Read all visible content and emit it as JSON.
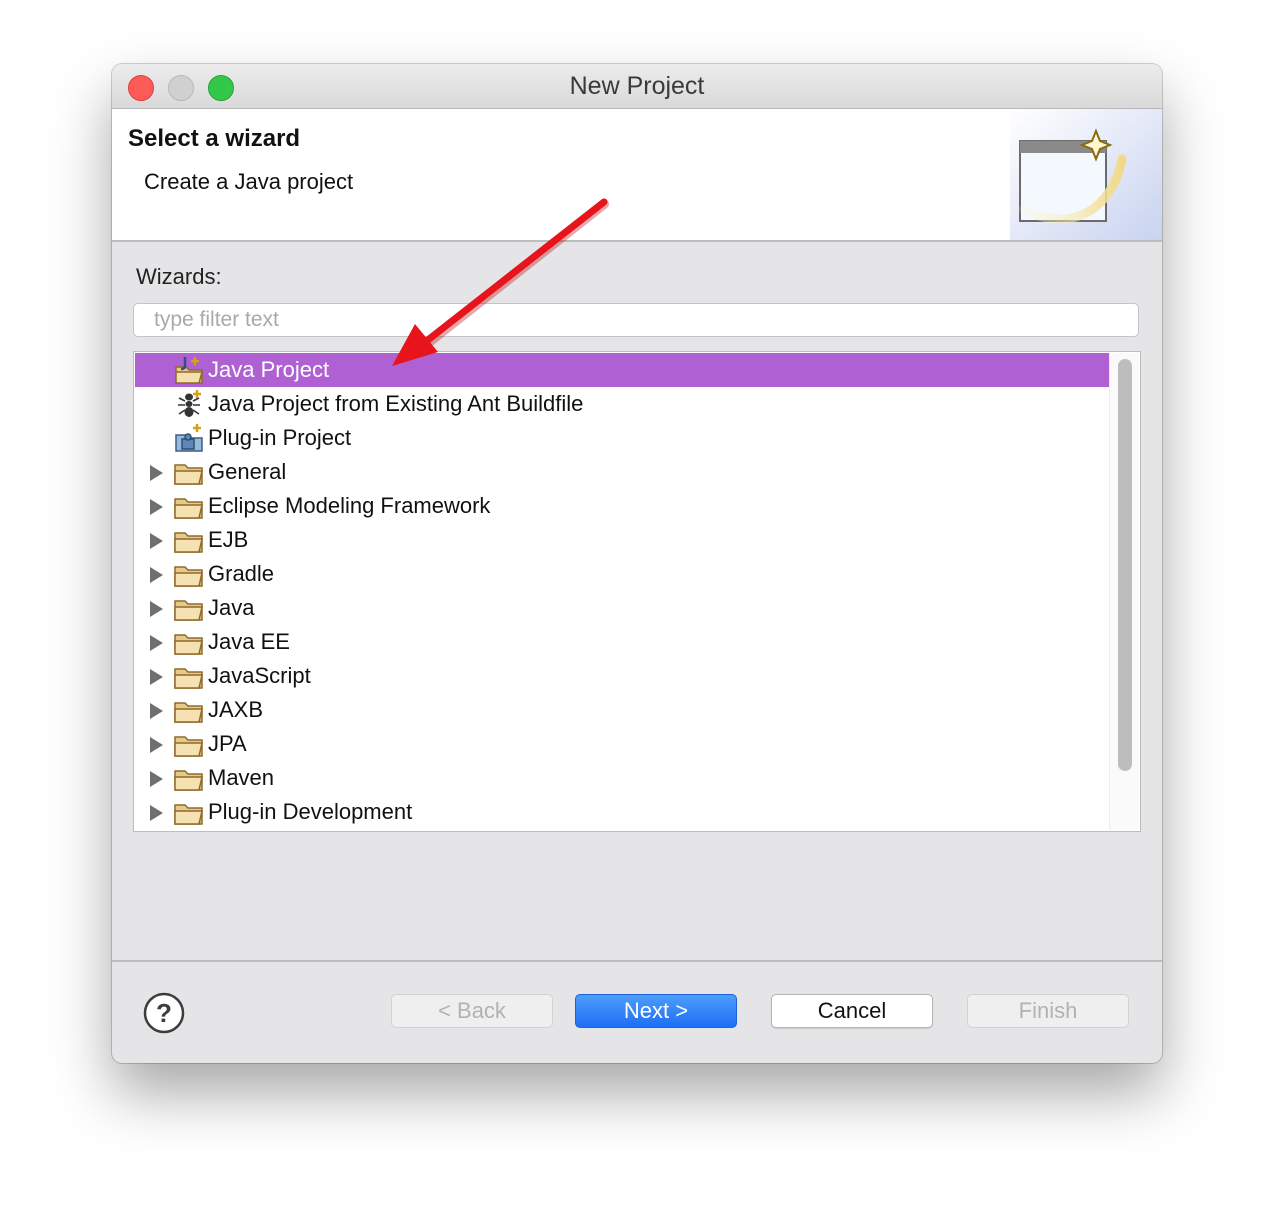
{
  "window": {
    "title": "New Project"
  },
  "header": {
    "title": "Select a wizard",
    "description": "Create a Java project"
  },
  "wizards_label": "Wizards:",
  "filter": {
    "placeholder": "type filter text",
    "value": ""
  },
  "tree": {
    "items": [
      {
        "label": "Java Project",
        "icon": "java-project-icon",
        "expandable": false,
        "selected": true
      },
      {
        "label": "Java Project from Existing Ant Buildfile",
        "icon": "ant-icon",
        "expandable": false,
        "selected": false
      },
      {
        "label": "Plug-in Project",
        "icon": "plugin-project-icon",
        "expandable": false,
        "selected": false
      },
      {
        "label": "General",
        "icon": "folder-icon",
        "expandable": true,
        "selected": false
      },
      {
        "label": "Eclipse Modeling Framework",
        "icon": "folder-icon",
        "expandable": true,
        "selected": false
      },
      {
        "label": "EJB",
        "icon": "folder-icon",
        "expandable": true,
        "selected": false
      },
      {
        "label": "Gradle",
        "icon": "folder-icon",
        "expandable": true,
        "selected": false
      },
      {
        "label": "Java",
        "icon": "folder-icon",
        "expandable": true,
        "selected": false
      },
      {
        "label": "Java EE",
        "icon": "folder-icon",
        "expandable": true,
        "selected": false
      },
      {
        "label": "JavaScript",
        "icon": "folder-icon",
        "expandable": true,
        "selected": false
      },
      {
        "label": "JAXB",
        "icon": "folder-icon",
        "expandable": true,
        "selected": false
      },
      {
        "label": "JPA",
        "icon": "folder-icon",
        "expandable": true,
        "selected": false
      },
      {
        "label": "Maven",
        "icon": "folder-icon",
        "expandable": true,
        "selected": false
      },
      {
        "label": "Plug-in Development",
        "icon": "folder-icon",
        "expandable": true,
        "selected": false
      }
    ]
  },
  "buttons": {
    "back": "< Back",
    "next": "Next >",
    "cancel": "Cancel",
    "finish": "Finish"
  },
  "colors": {
    "selection": "#af60d3",
    "default_button": "#1d6ff5",
    "annotation_arrow": "#e8141c"
  }
}
